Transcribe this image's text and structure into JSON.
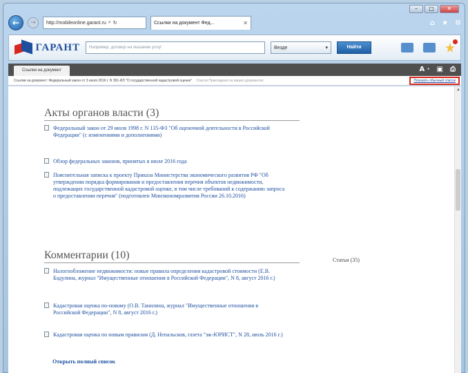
{
  "browser": {
    "address": "http://mobileonline.garant.ru",
    "address_domain": "garant",
    "address_suffix": ".ru",
    "tab_title": "Ссылки на документ Фед...",
    "icons": [
      "home-icon",
      "star-icon",
      "gear-icon"
    ]
  },
  "toolbar": {
    "logo_text": "ГАРАНТ",
    "search_placeholder": "Например, договор на оказание услуг",
    "scope_value": "Везде",
    "find_label": "Найти"
  },
  "doc_tab": {
    "label": "Ссылки на документ"
  },
  "doc_tools": {
    "font_label": "A ·"
  },
  "breadcrumb": {
    "text": "Ссылки на документ: Федеральный закон от 3 июля 2016 г. N 361-ФЗ \"О государственной кадастровой оценке\"",
    "gray": "Список Прикладная на ваших документах",
    "link": "Показать обычный список"
  },
  "sections": {
    "acts": {
      "title": "Акты органов власти (3)",
      "items": [
        "Федеральный закон от 29 июля 1998 г. N 135-ФЗ \"Об оценочной деятельности в Российской Федерации\" (с изменениями и дополнениями)",
        "Обзор федеральных законов, принятых в июле 2016 года",
        "Пояснительная записка к проекту Приказа Министерства экономического развития РФ \"Об утверждении порядка формирования и предоставления перечня объектов недвижимости, подлежащих государственной кадастровой оценке, в том числе требований к содержанию запроса о предоставлении перечня\" (подготовлен Минэкономразвития России 26.10.2016)"
      ]
    },
    "comments": {
      "title": "Комментарии (10)",
      "items": [
        "Налогообложение недвижимости: новые правила определения кадастровой стоимости (Е.В. Бадулина, журнал \"Имущественные отношения в Российской Федерации\", N 8, август 2016 г.)",
        "Кадастровая оценка по-новому (О.В. Танилина, журнал \"Имущественные отношения в Российской Федерации\", N 8, август 2016 г.)",
        "Кадастровая оценка по новым правилам (Д. Непальсков, газета \"эж-ЮРИСТ\", N 28, июль 2016 г.)"
      ],
      "more": "Открыть полный список"
    },
    "articles": {
      "label": "Статьи (35)"
    }
  }
}
